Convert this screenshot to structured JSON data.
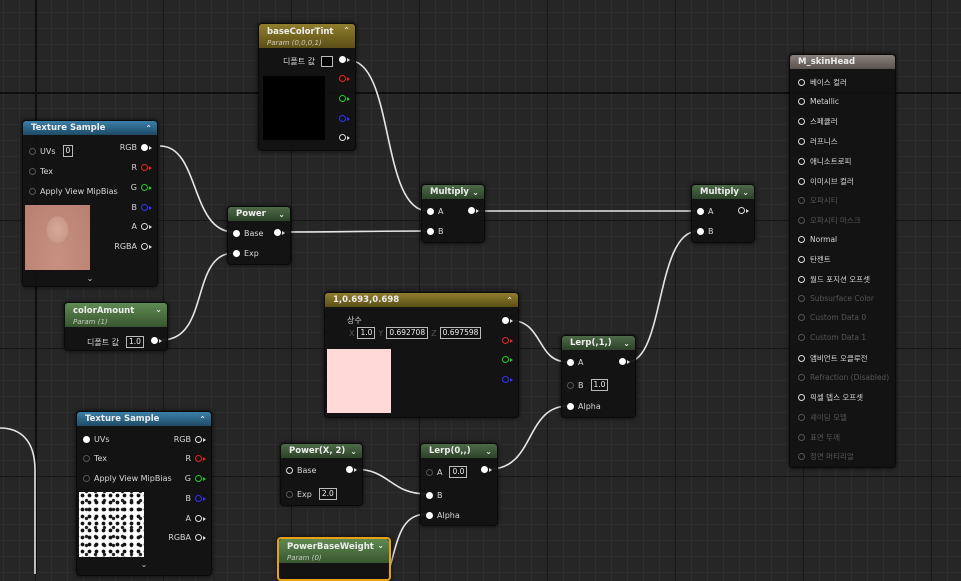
{
  "nodes": {
    "base_color_tint": {
      "title": "baseColorTint",
      "subtitle": "Param (0,0,0,1)",
      "default_label": "디폴트 값"
    },
    "texture_sample_1": {
      "title": "Texture Sample",
      "uvs_label": "UVs",
      "uvs_value": "0",
      "tex_label": "Tex",
      "mip_label": "Apply View MipBias",
      "out_rgb": "RGB",
      "out_r": "R",
      "out_g": "G",
      "out_b": "B",
      "out_a": "A",
      "out_rgba": "RGBA"
    },
    "power": {
      "title": "Power",
      "base_label": "Base",
      "exp_label": "Exp"
    },
    "color_amount": {
      "title": "colorAmount",
      "subtitle": "Param (1)",
      "default_label": "디폴트 값",
      "default_value": "1.0"
    },
    "multiply_1": {
      "title": "Multiply",
      "a_label": "A",
      "b_label": "B"
    },
    "multiply_2": {
      "title": "Multiply",
      "a_label": "A",
      "b_label": "B"
    },
    "constant3": {
      "title": "1,0.693,0.698",
      "const_label": "상수",
      "x_label": "X",
      "x_value": "1.0",
      "y_label": "Y",
      "y_value": "0.692708",
      "z_label": "Z",
      "z_value": "0.697598",
      "swatch_color": "#ffd8d8"
    },
    "lerp_1": {
      "title": "Lerp(,1,)",
      "a_label": "A",
      "b_label": "B",
      "b_value": "1.0",
      "alpha_label": "Alpha"
    },
    "texture_sample_2": {
      "title": "Texture Sample",
      "uvs_label": "UVs",
      "tex_label": "Tex",
      "mip_label": "Apply View MipBias",
      "out_rgb": "RGB",
      "out_r": "R",
      "out_g": "G",
      "out_b": "B",
      "out_a": "A",
      "out_rgba": "RGBA"
    },
    "power_x2": {
      "title": "Power(X, 2)",
      "base_label": "Base",
      "exp_label": "Exp",
      "exp_value": "2.0"
    },
    "lerp_0": {
      "title": "Lerp(0,,)",
      "a_label": "A",
      "a_value": "0.0",
      "b_label": "B",
      "alpha_label": "Alpha"
    },
    "power_base_weight": {
      "title": "PowerBaseWeight",
      "subtitle": "Param (0)"
    },
    "material": {
      "title": "M_skinHead",
      "inputs": [
        {
          "label": "베이스 컬러",
          "enabled": true
        },
        {
          "label": "Metallic",
          "enabled": true
        },
        {
          "label": "스페큘러",
          "enabled": true
        },
        {
          "label": "러프니스",
          "enabled": true
        },
        {
          "label": "애니소트로피",
          "enabled": true
        },
        {
          "label": "이미시브 컬러",
          "enabled": true
        },
        {
          "label": "오파시티",
          "enabled": false
        },
        {
          "label": "오파시티 마스크",
          "enabled": false
        },
        {
          "label": "Normal",
          "enabled": true
        },
        {
          "label": "탄젠트",
          "enabled": true
        },
        {
          "label": "월드 포지션 오프셋",
          "enabled": true
        },
        {
          "label": "Subsurface Color",
          "enabled": false
        },
        {
          "label": "Custom Data 0",
          "enabled": false
        },
        {
          "label": "Custom Data 1",
          "enabled": false
        },
        {
          "label": "앰비언트 오클루전",
          "enabled": true
        },
        {
          "label": "Refraction (Disabled)",
          "enabled": false
        },
        {
          "label": "픽셀 뎁스 오프셋",
          "enabled": true
        },
        {
          "label": "셰이딩 모델",
          "enabled": false
        },
        {
          "label": "표면 두께",
          "enabled": false
        },
        {
          "label": "정면 머티리얼",
          "enabled": false
        }
      ]
    }
  },
  "colors": {
    "texture_header": "#3b7fa8",
    "param_header": "#5f8a52",
    "vector_header": "#8f7d2e",
    "op_header": "#4d6a48",
    "material_header": "#8a817c",
    "wire": "#e6e6e6"
  }
}
